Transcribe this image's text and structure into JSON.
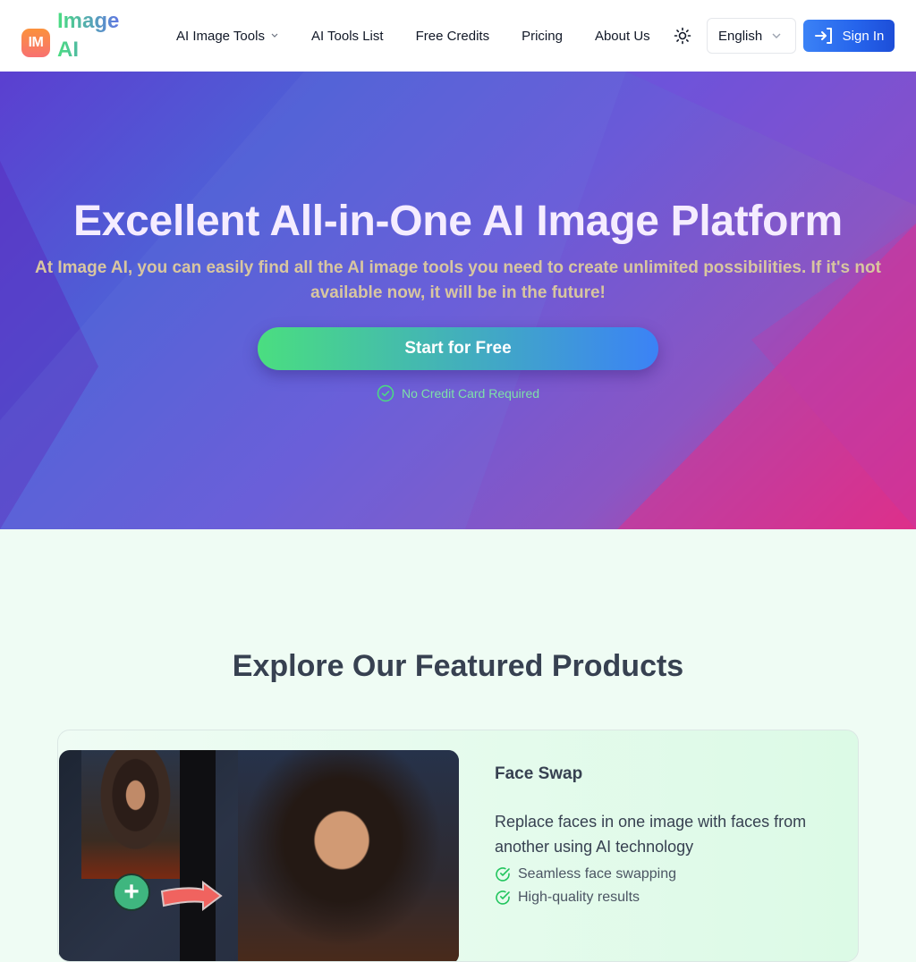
{
  "header": {
    "logo_badge": "IM",
    "logo_text": "Image AI",
    "nav": [
      {
        "label": "AI Image Tools",
        "has_dropdown": true
      },
      {
        "label": "AI Tools List"
      },
      {
        "label": "Free Credits"
      },
      {
        "label": "Pricing"
      },
      {
        "label": "About Us"
      }
    ],
    "theme_icon": "sun-icon",
    "language": "English",
    "sign_in": "Sign In"
  },
  "hero": {
    "title": "Excellent All-in-One AI Image Platform",
    "subtitle": "At Image AI, you can easily find all the AI image tools you need to create unlimited possibilities. If it's not available now, it will be in the future!",
    "cta": "Start for Free",
    "note": "No Credit Card Required"
  },
  "featured": {
    "title": "Explore Our Featured Products",
    "products": [
      {
        "name": "Face Swap",
        "description": "Replace faces in one image with faces from another using AI technology",
        "features": [
          "Seamless face swapping",
          "High-quality results"
        ]
      }
    ]
  },
  "colors": {
    "accent_blue": "#3b82f6",
    "accent_green": "#4ade80",
    "check_green": "#22c55e"
  }
}
